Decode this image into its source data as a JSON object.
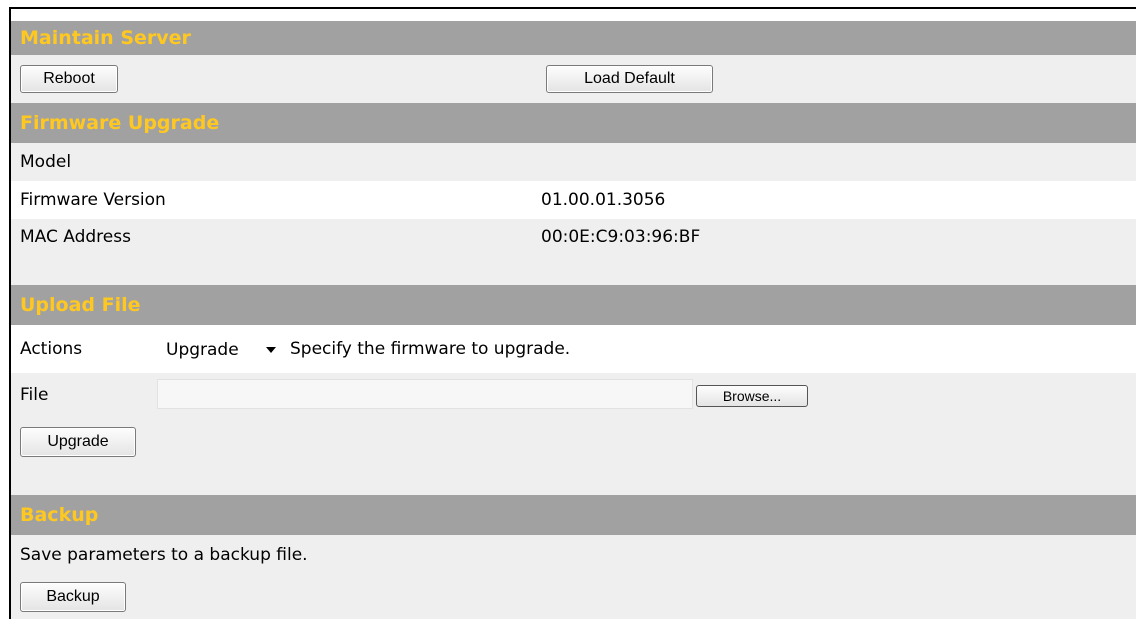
{
  "maintain": {
    "title": "Maintain Server",
    "reboot_label": "Reboot",
    "load_default_label": "Load Default"
  },
  "firmware": {
    "title": "Firmware Upgrade",
    "model_label": "Model",
    "model_value": "",
    "version_label": "Firmware Version",
    "version_value": "01.00.01.3056",
    "mac_label": "MAC Address",
    "mac_value": "00:0E:C9:03:96:BF"
  },
  "upload": {
    "title": "Upload File",
    "actions_label": "Actions",
    "actions_selected": "Upgrade",
    "actions_hint": "Specify the firmware to upgrade.",
    "file_label": "File",
    "file_value": "",
    "browse_label": "Browse...",
    "upgrade_label": "Upgrade"
  },
  "backup": {
    "title": "Backup",
    "description": "Save parameters to a backup file.",
    "backup_label": "Backup"
  },
  "colors": {
    "header_bg": "#a1a1a1",
    "header_text": "#ffc821",
    "row_bg": "#efefef"
  }
}
